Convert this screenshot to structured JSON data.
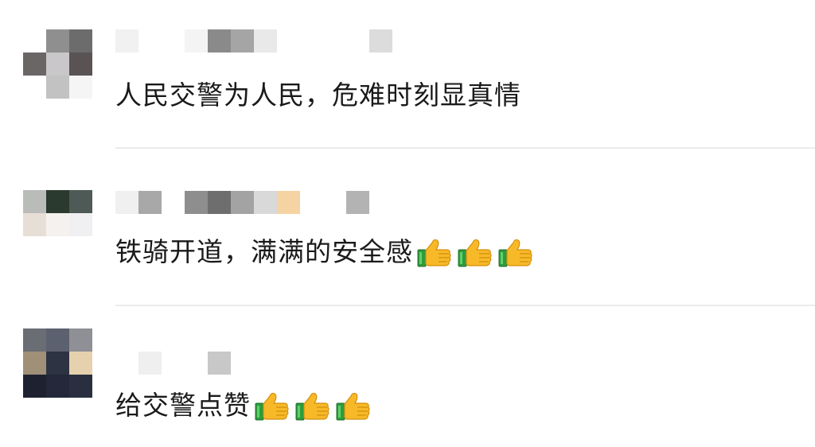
{
  "comments": [
    {
      "text": "人民交警为人民，危难时刻显真情",
      "thumbs": 0,
      "avatar": [
        [
          "#ffffff",
          "#8f8f8f",
          "#6c6c6c"
        ],
        [
          "#6a6666",
          "#c9c7c9",
          "#5a5353"
        ],
        [
          "#ffffff",
          "#c2c2c2",
          "#f5f5f5"
        ]
      ],
      "name_blocks": [
        "#f1f1f1",
        null,
        null,
        "#f4f4f4",
        "#8a8a8a",
        "#a5a5a5",
        "#e9e9e9",
        null,
        null,
        null,
        null,
        "#dcdcdc"
      ]
    },
    {
      "text": "铁骑开道，满满的安全感",
      "thumbs": 3,
      "avatar": [
        [
          "#b9bcb9",
          "#2b3a2e",
          "#4e5a56"
        ],
        [
          "#e7dfd6",
          "#f5f1ee",
          "#f0eff1"
        ],
        [
          "#ffffff",
          "#ffffff",
          "#ffffff"
        ]
      ],
      "name_blocks": [
        "#f0f0f0",
        "#a8a8a8",
        null,
        "#8e8e8e",
        "#6e6e6e",
        "#a3a3a3",
        "#d9d9d9",
        "#f6d3a3",
        null,
        null,
        "#b3b3b3"
      ]
    },
    {
      "text": "给交警点赞",
      "thumbs": 3,
      "avatar": [
        [
          "#6b6d74",
          "#5c6170",
          "#8f9096"
        ],
        [
          "#a09078",
          "#2d3342",
          "#e5d1ad"
        ],
        [
          "#1e2230",
          "#24283a",
          "#2a2f40"
        ]
      ],
      "name_blocks": [
        null,
        "#efefef",
        null,
        null,
        "#c8c8c8"
      ]
    }
  ]
}
